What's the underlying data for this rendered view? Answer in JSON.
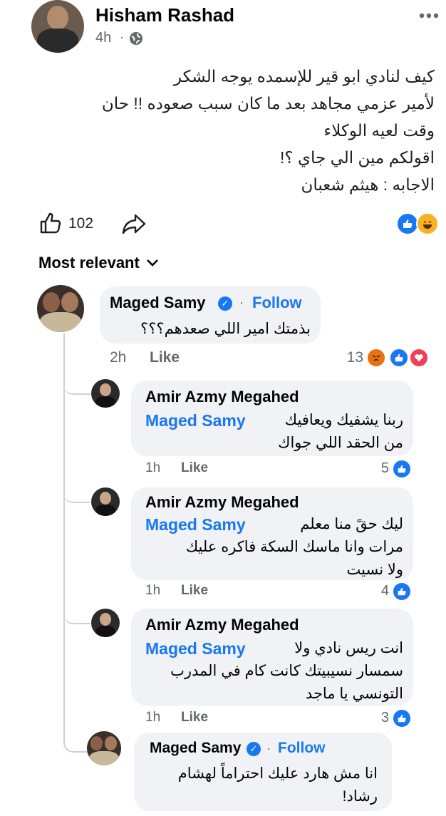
{
  "post": {
    "author": "Hisham Rashad",
    "time": "4h",
    "separator": "·",
    "lines": [
      "كيف لنادي ابو قير للإسمده يوجه الشكر",
      "لأمير عزمي مجاهد بعد ما كان سبب صعوده !!  حان",
      "وقت لعيه الوكلاء",
      "اقولكم مين الي جاي ؟!",
      "الاجابه : هيثم شعبان"
    ],
    "like_count": "102"
  },
  "sort_label": "Most relevant",
  "comments": [
    {
      "name": "Maged Samy",
      "follow": "Follow",
      "separator": "·",
      "text": "بذمتك امير اللي صعدهم؟؟؟",
      "time": "2h",
      "like": "Like",
      "count": "13"
    },
    {
      "name": "Amir Azmy Megahed",
      "mention": "Maged Samy",
      "text_line1": "ربنا يشفيك ويعافيك",
      "text_line2": "من الحقد  اللي جواك",
      "time": "1h",
      "like": "Like",
      "count": "5"
    },
    {
      "name": "Amir Azmy Megahed",
      "mention": "Maged Samy",
      "text_line1": "ليك حقً منا معلم",
      "text_line2": "مرات  وانا ماسك  السكة  فاكره عليك",
      "text_line3": "ولا نسيت",
      "time": "1h",
      "like": "Like",
      "count": "4"
    },
    {
      "name": "Amir Azmy Megahed",
      "mention": "Maged Samy",
      "text_line1": "انت ريس نادي ولا",
      "text_line2": "سمسار نسيبيتك كانت كام في المدرب",
      "text_line3": "التونسي يا ماجد",
      "time": "1h",
      "like": "Like",
      "count": "3"
    },
    {
      "name": "Maged Samy",
      "follow": "Follow",
      "separator": "·",
      "text_line1": "انا مش هارد عليك احتراماً لهشام",
      "text_line2": "رشاد!"
    }
  ],
  "colors": {
    "accent": "#1877f2",
    "bubble": "#f0f2f5",
    "meta": "#65676b"
  },
  "icons": [
    "globe-icon",
    "more-icon",
    "like-icon",
    "share-icon",
    "chevron-down-icon",
    "verified-icon",
    "angry-reaction-icon",
    "like-reaction-icon",
    "love-reaction-icon",
    "haha-reaction-icon"
  ]
}
